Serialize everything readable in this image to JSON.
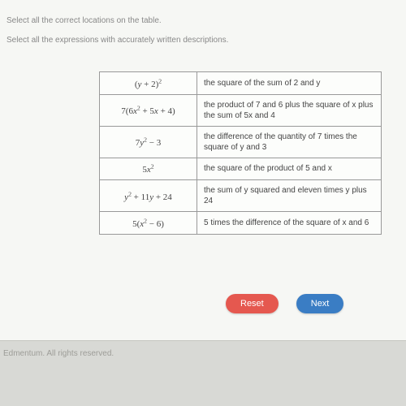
{
  "instructions": {
    "line1": "Select all the correct locations on the table.",
    "line2": "Select all the expressions with accurately written descriptions."
  },
  "table": {
    "rows": [
      {
        "expr_html": "(<i>y</i> + 2)<span class='sup'>2</span>",
        "desc": "the square of the sum of 2 and y"
      },
      {
        "expr_html": "7(6<i>x</i><span class='sup'>2</span> + 5<i>x</i> + 4)",
        "desc": "the product of 7 and 6 plus the square of x plus the sum of 5x and 4"
      },
      {
        "expr_html": "7<i>y</i><span class='sup'>2</span> − 3",
        "desc": "the difference of the quantity of 7 times the square of y and 3"
      },
      {
        "expr_html": "5<i>x</i><span class='sup'>2</span>",
        "desc": "the square of the product of 5 and x"
      },
      {
        "expr_html": "<i>y</i><span class='sup'>2</span> + 11<i>y</i> + 24",
        "desc": "the sum of y squared and eleven times y plus 24"
      },
      {
        "expr_html": "5(<i>x</i><span class='sup'>2</span> − 6)",
        "desc": "5 times the difference of the square of x and 6"
      }
    ]
  },
  "buttons": {
    "reset": "Reset",
    "next": "Next"
  },
  "footer": "Edmentum. All rights reserved."
}
